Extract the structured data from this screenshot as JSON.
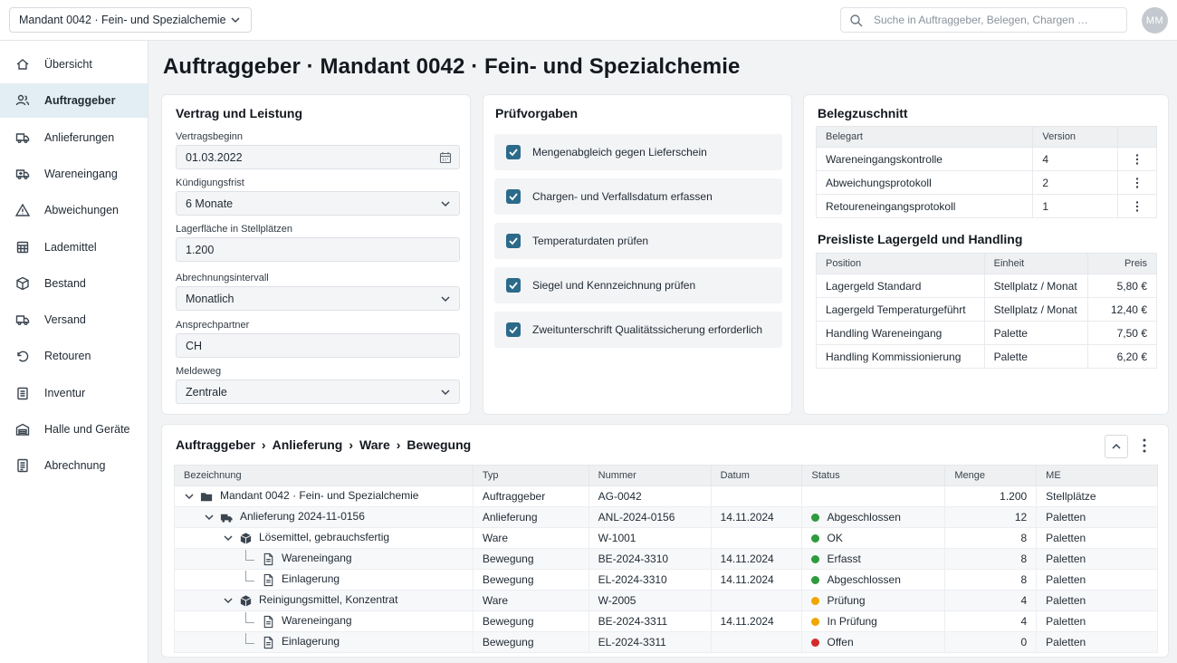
{
  "topbar": {
    "tenant": "Mandant 0042 · Fein- und Spezialchemie",
    "search_placeholder": "Suche in Auftraggeber, Belegen, Chargen …",
    "avatar": "MM"
  },
  "sidebar": {
    "items": [
      {
        "label": "Übersicht",
        "icon": "home-icon"
      },
      {
        "label": "Auftraggeber",
        "icon": "users-icon",
        "active": true
      },
      {
        "label": "Anlieferungen",
        "icon": "truck-icon"
      },
      {
        "label": "Wareneingang",
        "icon": "inbound-truck-icon"
      },
      {
        "label": "Abweichungen",
        "icon": "warning-icon"
      },
      {
        "label": "Lademittel",
        "icon": "pallet-icon"
      },
      {
        "label": "Bestand",
        "icon": "box-icon"
      },
      {
        "label": "Versand",
        "icon": "shipping-icon"
      },
      {
        "label": "Retouren",
        "icon": "return-icon"
      },
      {
        "label": "Inventur",
        "icon": "clipboard-icon"
      },
      {
        "label": "Halle und Geräte",
        "icon": "warehouse-icon"
      },
      {
        "label": "Abrechnung",
        "icon": "invoice-icon"
      }
    ]
  },
  "page": {
    "title": "Auftraggeber · Mandant 0042 · Fein- und Spezialchemie"
  },
  "contract": {
    "title": "Vertrag und Leistung",
    "fields": [
      {
        "label": "Vertragsbeginn",
        "value": "01.03.2022",
        "kind": "date"
      },
      {
        "label": "Kündigungsfrist",
        "value": "6 Monate",
        "kind": "select"
      },
      {
        "label": "Lagerfläche in Stellplätzen",
        "value": "1.200",
        "kind": "text"
      },
      {
        "label": "Abrechnungsintervall",
        "value": "Monatlich",
        "kind": "select"
      },
      {
        "label": "Ansprechpartner",
        "value": "CH",
        "kind": "text"
      },
      {
        "label": "Meldeweg",
        "value": "Zentrale",
        "kind": "select"
      }
    ]
  },
  "checks": {
    "title": "Prüfvorgaben",
    "items": [
      {
        "label": "Mengenabgleich gegen Lieferschein",
        "checked": true
      },
      {
        "label": "Chargen- und Verfallsdatum erfassen",
        "checked": true
      },
      {
        "label": "Temperaturdaten prüfen",
        "checked": true
      },
      {
        "label": "Siegel und Kennzeichnung prüfen",
        "checked": true
      },
      {
        "label": "Zweitunterschrift Qualitätssicherung erforderlich",
        "checked": true
      }
    ]
  },
  "documents": {
    "title": "Belegzuschnitt",
    "headers": [
      "Belegart",
      "Version"
    ],
    "rows": [
      {
        "type": "Wareneingangskontrolle",
        "version": "4"
      },
      {
        "type": "Abweichungsprotokoll",
        "version": "2"
      },
      {
        "type": "Retoureneingangsprotokoll",
        "version": "1"
      }
    ]
  },
  "prices": {
    "title": "Preisliste Lagergeld und Handling",
    "headers": [
      "Position",
      "Einheit",
      "Preis"
    ],
    "rows": [
      {
        "position": "Lagergeld Standard",
        "unit": "Stellplatz / Monat",
        "price": "5,80 €"
      },
      {
        "position": "Lagergeld Temperaturgeführt",
        "unit": "Stellplatz / Monat",
        "price": "12,40 €"
      },
      {
        "position": "Handling Wareneingang",
        "unit": "Palette",
        "price": "7,50 €"
      },
      {
        "position": "Handling Kommissionierung",
        "unit": "Palette",
        "price": "6,20 €"
      }
    ]
  },
  "tree": {
    "breadcrumb": [
      "Auftraggeber",
      "Anlieferung",
      "Ware",
      "Bewegung"
    ],
    "headers": [
      "Bezeichnung",
      "Typ",
      "Nummer",
      "Datum",
      "Status",
      "Menge",
      "ME"
    ],
    "status_colors": {
      "green": "#2e9b3e",
      "amber": "#f0a500",
      "red": "#d62a2a"
    },
    "rows": [
      {
        "level": 0,
        "icon": "folder-icon",
        "toggle": true,
        "name": "Mandant 0042 · Fein- und Spezialchemie",
        "type": "Auftraggeber",
        "number": "AG-0042",
        "date": "",
        "status": "",
        "status_color": "",
        "qty": "1.200",
        "unit": "Stellplätze"
      },
      {
        "level": 1,
        "icon": "truck-icon",
        "toggle": true,
        "name": "Anlieferung 2024-11-0156",
        "type": "Anlieferung",
        "number": "ANL-2024-0156",
        "date": "14.11.2024",
        "status": "Abgeschlossen",
        "status_color": "green",
        "qty": "12",
        "unit": "Paletten"
      },
      {
        "level": 2,
        "icon": "box-icon",
        "toggle": true,
        "name": "Lösemittel, gebrauchsfertig",
        "type": "Ware",
        "number": "W-1001",
        "date": "",
        "status": "OK",
        "status_color": "green",
        "qty": "8",
        "unit": "Paletten"
      },
      {
        "level": 3,
        "icon": "document-icon",
        "toggle": false,
        "name": "Wareneingang",
        "type": "Bewegung",
        "number": "BE-2024-3310",
        "date": "14.11.2024",
        "status": "Erfasst",
        "status_color": "green",
        "qty": "8",
        "unit": "Paletten"
      },
      {
        "level": 3,
        "icon": "document-icon",
        "toggle": false,
        "name": "Einlagerung",
        "type": "Bewegung",
        "number": "EL-2024-3310",
        "date": "14.11.2024",
        "status": "Abgeschlossen",
        "status_color": "green",
        "qty": "8",
        "unit": "Paletten"
      },
      {
        "level": 2,
        "icon": "box-icon",
        "toggle": true,
        "name": "Reinigungsmittel, Konzentrat",
        "type": "Ware",
        "number": "W-2005",
        "date": "",
        "status": "Prüfung",
        "status_color": "amber",
        "qty": "4",
        "unit": "Paletten"
      },
      {
        "level": 3,
        "icon": "document-icon",
        "toggle": false,
        "name": "Wareneingang",
        "type": "Bewegung",
        "number": "BE-2024-3311",
        "date": "14.11.2024",
        "status": "In Prüfung",
        "status_color": "amber",
        "qty": "4",
        "unit": "Paletten"
      },
      {
        "level": 3,
        "icon": "document-icon",
        "toggle": false,
        "name": "Einlagerung",
        "type": "Bewegung",
        "number": "EL-2024-3311",
        "date": "",
        "status": "Offen",
        "status_color": "red",
        "qty": "0",
        "unit": "Paletten"
      }
    ]
  }
}
